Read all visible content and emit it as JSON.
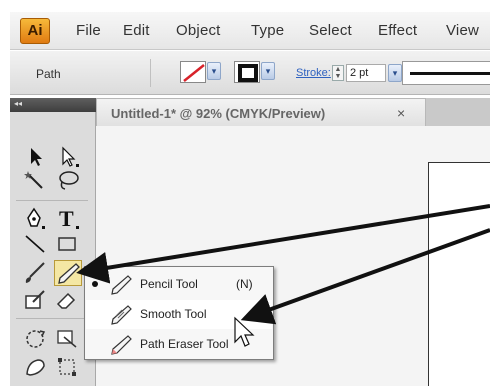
{
  "app": {
    "logo_text": "Ai",
    "accent": "#e89a1c"
  },
  "menu": {
    "items": [
      "File",
      "Edit",
      "Object",
      "Type",
      "Select",
      "Effect",
      "View"
    ]
  },
  "control_bar": {
    "selection_label": "Path",
    "fill_swatch": "red-slash-none",
    "stroke_swatch": "black-square",
    "stroke_label": "Stroke:",
    "stroke_value": "2 pt"
  },
  "document": {
    "tab_title": "Untitled-1* @ 92% (CMYK/Preview)",
    "tab_close": "×"
  },
  "flyout": {
    "items": [
      {
        "label": "Pencil Tool",
        "shortcut": "(N)",
        "icon": "pencil-icon",
        "active": true
      },
      {
        "label": "Smooth Tool",
        "shortcut": "",
        "icon": "smooth-icon",
        "active": false
      },
      {
        "label": "Path Eraser Tool",
        "shortcut": "",
        "icon": "path-eraser-icon",
        "active": false
      }
    ]
  },
  "tools_panel": {
    "collapse_glyph": "◂◂",
    "tools": [
      "selection-tool-icon",
      "direct-selection-tool-icon",
      "magic-wand-tool-icon",
      "lasso-tool-icon",
      "pen-tool-icon",
      "type-tool-icon",
      "line-segment-tool-icon",
      "rectangle-tool-icon",
      "paintbrush-tool-icon",
      "pencil-tool-icon",
      "blob-brush-tool-icon",
      "eraser-tool-icon",
      "rotate-tool-icon",
      "scale-tool-icon",
      "warp-tool-icon",
      "free-transform-tool-icon"
    ]
  },
  "annotation": {
    "arrow_color": "#111111"
  }
}
